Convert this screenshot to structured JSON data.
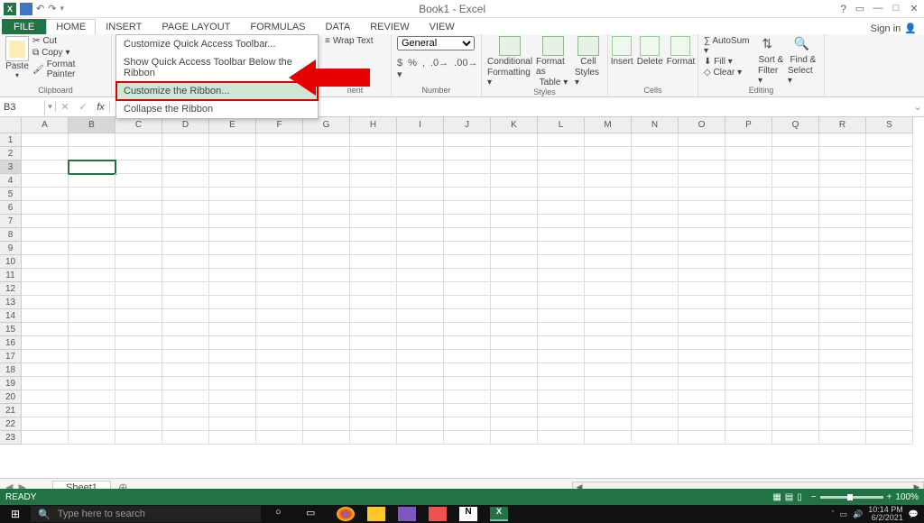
{
  "titlebar": {
    "title": "Book1 - Excel",
    "xl": "X"
  },
  "tabs": {
    "file": "FILE",
    "home": "HOME",
    "insert": "INSERT",
    "pagelayout": "PAGE LAYOUT",
    "formulas": "FORMULAS",
    "data": "DATA",
    "review": "REVIEW",
    "view": "VIEW",
    "signin": "Sign in"
  },
  "ribbon": {
    "clipboard": {
      "paste": "Paste",
      "cut": "Cut",
      "copy": "Copy",
      "fp": "Format Painter",
      "label": "Clipboard"
    },
    "alignment": {
      "wrap": "Wrap Text",
      "label": "nent"
    },
    "number": {
      "format": "General",
      "dollar": "$",
      "percent": "%",
      "comma": ",",
      "inc": ".0",
      "dec": ".00",
      "label": "Number"
    },
    "styles": {
      "cond": "Conditional",
      "cond2": "Formatting",
      "fat": "Format as",
      "fat2": "Table",
      "cell": "Cell",
      "cell2": "Styles",
      "label": "Styles"
    },
    "cells": {
      "insert": "Insert",
      "delete": "Delete",
      "format": "Format",
      "label": "Cells"
    },
    "editing": {
      "autosum": "AutoSum",
      "fill": "Fill",
      "clear": "Clear",
      "sort": "Sort &",
      "sort2": "Filter",
      "find": "Find &",
      "find2": "Select",
      "label": "Editing"
    }
  },
  "dropdown": {
    "item1": "Customize Quick Access Toolbar...",
    "item2": "Show Quick Access Toolbar Below the Ribbon",
    "item3": "Customize the Ribbon...",
    "item4": "Collapse the Ribbon"
  },
  "namebox": {
    "ref": "B3"
  },
  "columns": [
    "A",
    "B",
    "C",
    "D",
    "E",
    "F",
    "G",
    "H",
    "I",
    "J",
    "K",
    "L",
    "M",
    "N",
    "O",
    "P",
    "Q",
    "R",
    "S"
  ],
  "rows": [
    "1",
    "2",
    "3",
    "4",
    "5",
    "6",
    "7",
    "8",
    "9",
    "10",
    "11",
    "12",
    "13",
    "14",
    "15",
    "16",
    "17",
    "18",
    "19",
    "20",
    "21",
    "22",
    "23"
  ],
  "sheetbar": {
    "sheet": "Sheet1"
  },
  "statusbar": {
    "ready": "READY",
    "zoom": "100%"
  },
  "taskbar": {
    "search": "Type here to search",
    "time": "10:14 PM",
    "date": "6/2/2021"
  }
}
